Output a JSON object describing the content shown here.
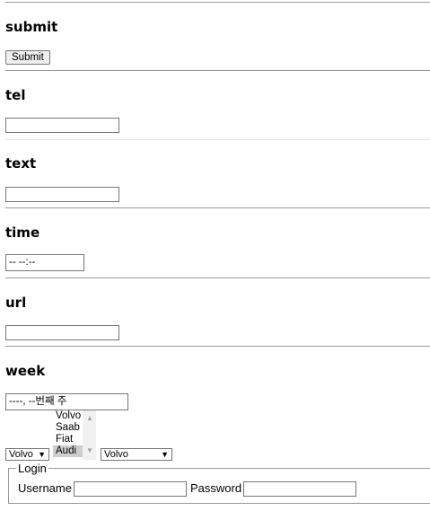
{
  "sections": {
    "submit": {
      "heading": "submit",
      "button_label": "Submit"
    },
    "tel": {
      "heading": "tel",
      "value": ""
    },
    "text": {
      "heading": "text",
      "value": ""
    },
    "time": {
      "heading": "time",
      "value": "-- --:--"
    },
    "url": {
      "heading": "url",
      "value": ""
    },
    "week": {
      "heading": "week",
      "value": "----, --번째 주"
    }
  },
  "listbox": {
    "options": [
      "Volvo",
      "Saab",
      "Fiat",
      "Audi"
    ],
    "selected": "Audi"
  },
  "dropdowns": {
    "first_value": "Volvo",
    "second_value": "Volvo"
  },
  "login": {
    "legend": "Login",
    "username_label": "Username",
    "password_label": "Password"
  }
}
